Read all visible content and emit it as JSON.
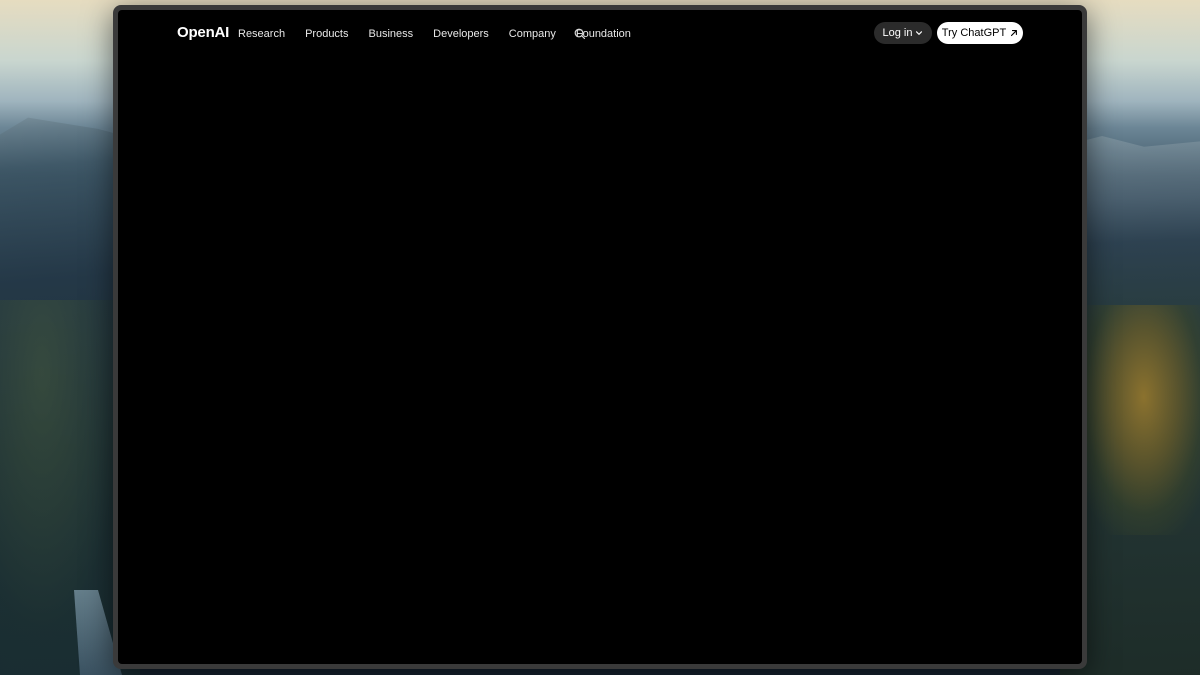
{
  "nav": {
    "logo": "OpenAI",
    "links": [
      {
        "label": "Research"
      },
      {
        "label": "Products"
      },
      {
        "label": "Business"
      },
      {
        "label": "Developers"
      },
      {
        "label": "Company"
      },
      {
        "label": "Foundation"
      }
    ],
    "search_icon": "search-icon",
    "login_label": "Log in",
    "login_icon": "chevron-down-icon",
    "cta_label": "Try ChatGPT",
    "cta_icon": "arrow-up-right-icon"
  },
  "colors": {
    "page_background": "#000000",
    "login_button_bg": "#2b2b2b",
    "cta_button_bg": "#ffffff"
  }
}
